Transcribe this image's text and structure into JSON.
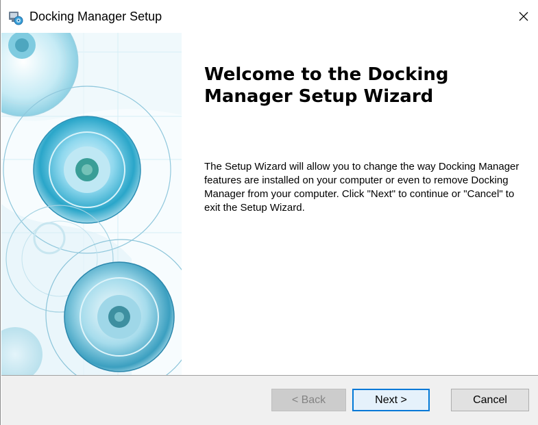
{
  "window": {
    "title": "Docking Manager Setup",
    "icon": "installer-icon",
    "close_glyph": "✕"
  },
  "banner": {
    "image": "decorative-circles-banner"
  },
  "content": {
    "title": "Welcome to the Docking Manager Setup Wizard",
    "description": "The Setup Wizard will allow you to change the way Docking Manager features are installed on your computer or even to remove Docking Manager from your computer.  Click \"Next\" to continue or \"Cancel\" to exit the Setup Wizard."
  },
  "buttons": {
    "back_label": "< Back",
    "back_enabled": false,
    "next_label": "Next >",
    "cancel_label": "Cancel"
  },
  "colors": {
    "focus_border": "#0078d7",
    "footer_bg": "#f0f0f0",
    "banner_accent": "#2aa6c9"
  }
}
